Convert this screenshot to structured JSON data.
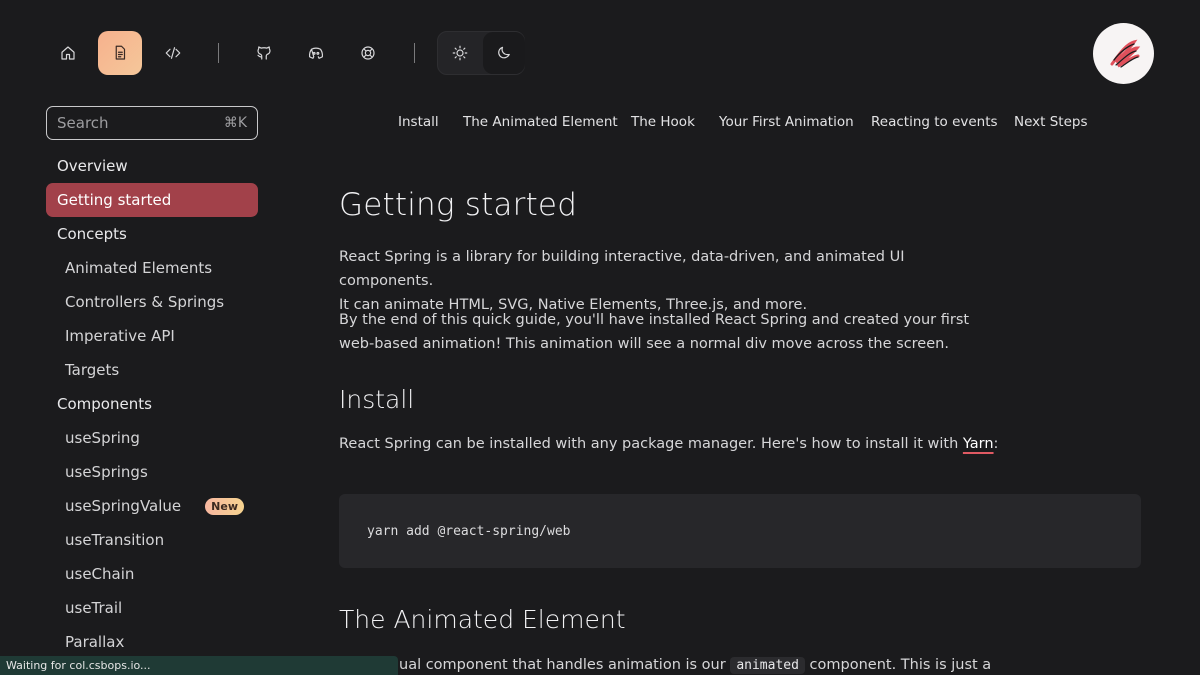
{
  "topbar": {
    "icons": [
      "home-icon",
      "docs-icon",
      "code-icon",
      "github-icon",
      "discord-icon",
      "help-icon",
      "sun-icon",
      "moon-icon"
    ]
  },
  "sidebar": {
    "search": {
      "placeholder": "Search",
      "shortcut": "⌘K"
    },
    "items": [
      {
        "label": "Overview",
        "kind": "section"
      },
      {
        "label": "Getting started",
        "kind": "section",
        "active": true
      },
      {
        "label": "Concepts",
        "kind": "section"
      },
      {
        "label": "Animated Elements",
        "kind": "sub"
      },
      {
        "label": "Controllers & Springs",
        "kind": "sub"
      },
      {
        "label": "Imperative API",
        "kind": "sub"
      },
      {
        "label": "Targets",
        "kind": "sub"
      },
      {
        "label": "Components",
        "kind": "section"
      },
      {
        "label": "useSpring",
        "kind": "sub"
      },
      {
        "label": "useSprings",
        "kind": "sub"
      },
      {
        "label": "useSpringValue",
        "kind": "sub",
        "badge": "New"
      },
      {
        "label": "useTransition",
        "kind": "sub"
      },
      {
        "label": "useChain",
        "kind": "sub"
      },
      {
        "label": "useTrail",
        "kind": "sub"
      },
      {
        "label": "Parallax",
        "kind": "sub"
      }
    ]
  },
  "toc": [
    "Install",
    "The Animated Element",
    "The Hook",
    "Your First Animation",
    "Reacting to events",
    "Next Steps"
  ],
  "content": {
    "title": "Getting started",
    "intro_1_line1": "React Spring is a library for building interactive, data-driven, and animated UI components.",
    "intro_1_line2": "It can animate HTML, SVG, Native Elements, Three.js, and more.",
    "intro_2_line1": "By the end of this quick guide, you'll have installed React Spring and created your first",
    "intro_2_line2": "web-based animation! This animation will see a normal div move across the screen.",
    "install_heading": "Install",
    "install_text": "React Spring can be installed with any package manager. Here's how to install it with ",
    "install_link": "Yarn",
    "install_suffix": ":",
    "code": "yarn add @react-spring/web",
    "animated_heading": "The Animated Element",
    "animated_text_pre": "ual component that handles animation is our",
    "animated_code": "animated",
    "animated_text_post": "component. This is just a"
  },
  "status": "Waiting for col.csbops.io...",
  "colors": {
    "background": "#1b1b1d",
    "accent": "#a2414a",
    "active_tab": "#f6b18d"
  }
}
